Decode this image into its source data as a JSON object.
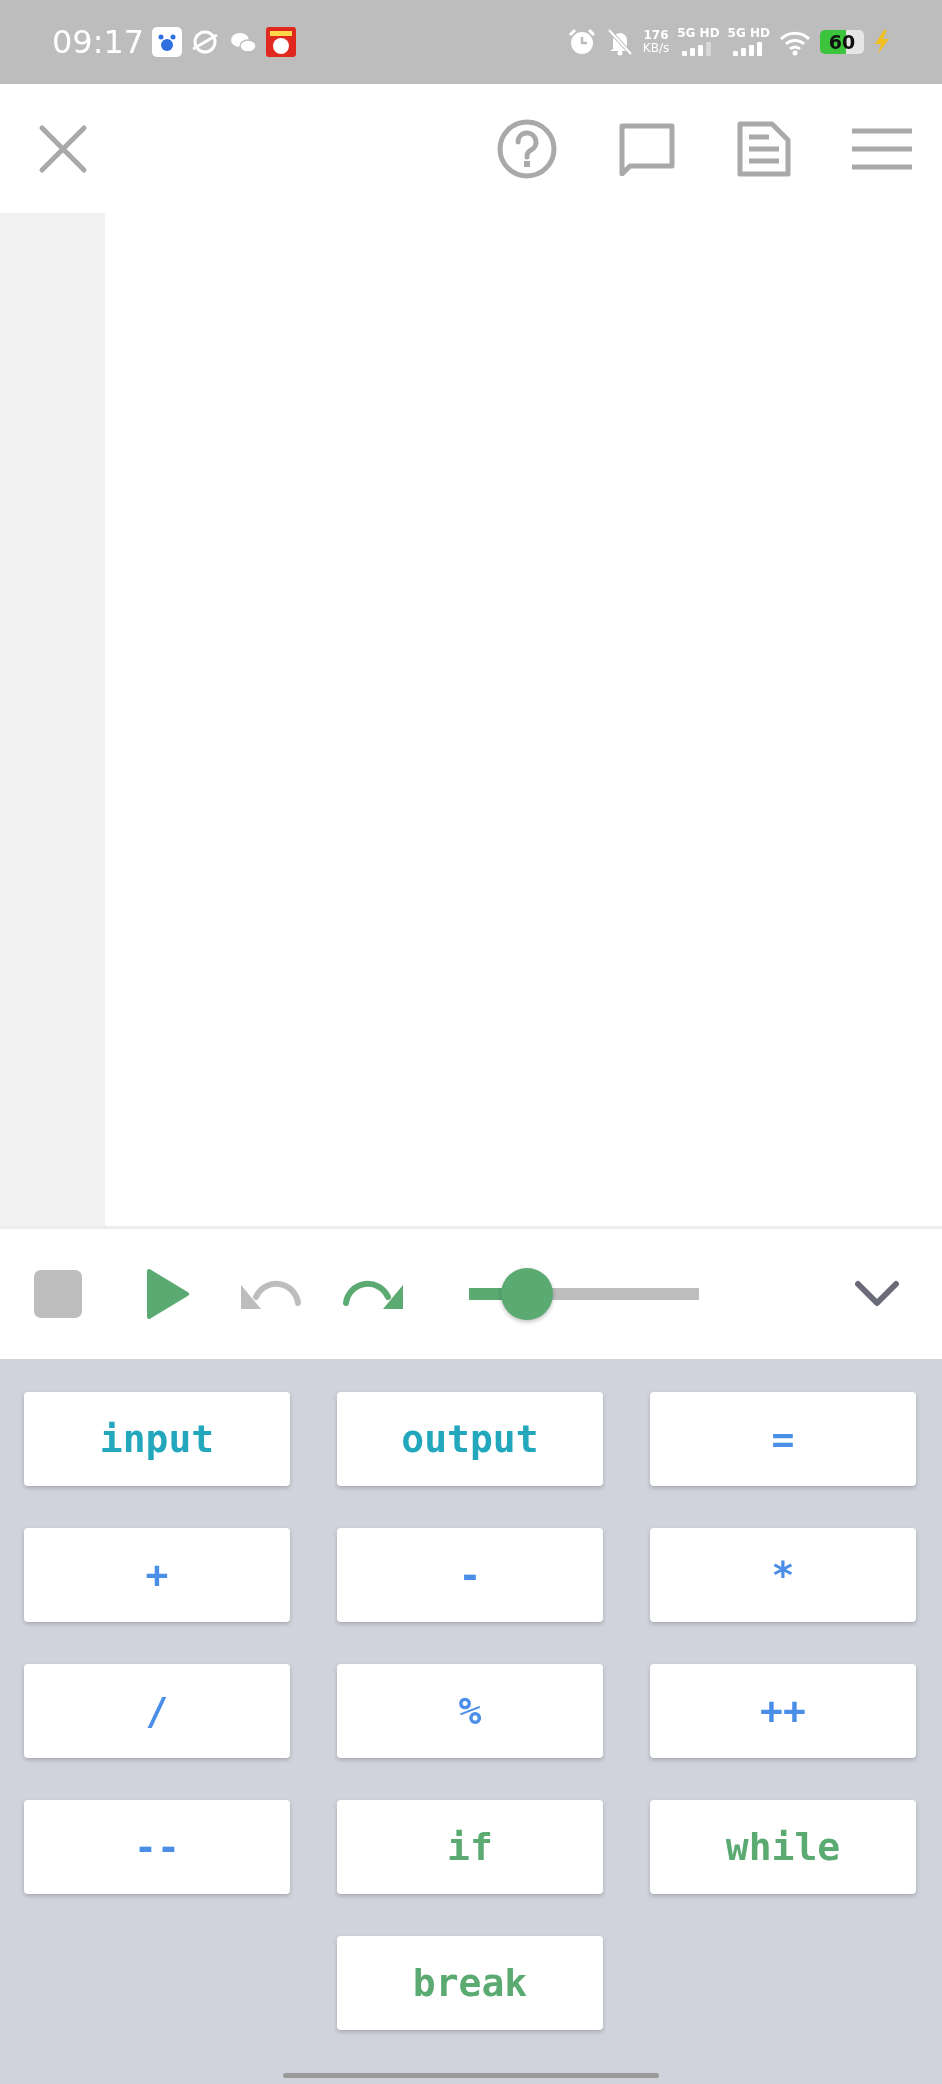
{
  "status_bar": {
    "time": "09:17",
    "speed_value": "176",
    "speed_unit": "KB/s",
    "networks": [
      {
        "label": "5G HD"
      },
      {
        "label": "5G HD"
      }
    ],
    "battery": {
      "text": "60",
      "charging": true
    }
  },
  "controls": {
    "stop": {
      "disabled": true
    },
    "run": {
      "disabled": false
    },
    "undo": {
      "disabled": true
    },
    "redo": {
      "disabled": false
    },
    "speed": {
      "level": 0.25
    },
    "collapse": {
      "expanded": true
    }
  },
  "keys": [
    {
      "label": "input",
      "kind": "io"
    },
    {
      "label": "output",
      "kind": "io"
    },
    {
      "label": "=",
      "kind": "op"
    },
    {
      "label": "+",
      "kind": "op"
    },
    {
      "label": "-",
      "kind": "op"
    },
    {
      "label": "*",
      "kind": "op"
    },
    {
      "label": "/",
      "kind": "op"
    },
    {
      "label": "%",
      "kind": "op"
    },
    {
      "label": "++",
      "kind": "op"
    },
    {
      "label": "--",
      "kind": "op"
    },
    {
      "label": "if",
      "kind": "keyword"
    },
    {
      "label": "while",
      "kind": "keyword"
    },
    {
      "label": "break",
      "kind": "keyword"
    }
  ]
}
